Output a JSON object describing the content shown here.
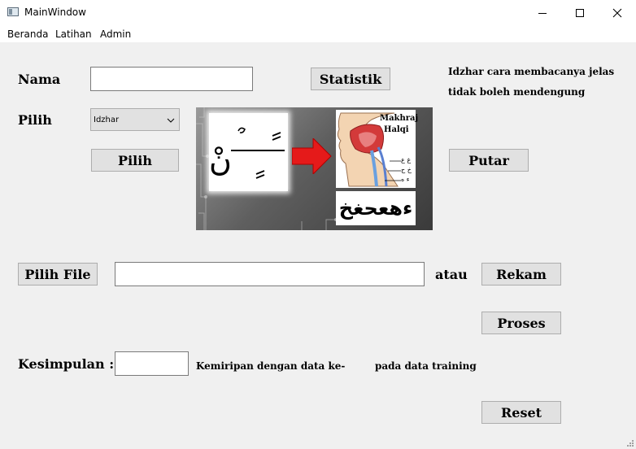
{
  "window": {
    "title": "MainWindow"
  },
  "menu": [
    "Beranda",
    "Latihan",
    "Admin"
  ],
  "form": {
    "nama_label": "Nama",
    "nama_value": "",
    "statistik_button": "Statistik",
    "description": [
      "Idzhar cara membacanya jelas",
      "tidak boleh mendengung"
    ],
    "pilih_label": "Pilih",
    "dropdown_selected": "Idzhar",
    "pilih_button": "Pilih",
    "putar_button": "Putar",
    "pilih_file_button": "Pilih File",
    "file_path_value": "",
    "atau_label": "atau",
    "rekam_button": "Rekam",
    "proses_button": "Proses",
    "kesimpulan_label": "Kesimpulan :",
    "kesimpulan_value": "",
    "kemiripan_text": "Kemiripan dengan data ke-",
    "training_text": "pada data training",
    "reset_button": "Reset"
  },
  "illustration": {
    "makhraj_title": [
      "Makhraj",
      "Halqi"
    ],
    "letters": "ءهعحغخ",
    "noon_sukun": "نْ",
    "mouth_labels": [
      "غ ع",
      "خ ح",
      "ء ه"
    ]
  },
  "colors": {
    "arrow": "#e51a1a",
    "window_bg": "#f0f0f0",
    "button_bg": "#e1e1e1"
  }
}
